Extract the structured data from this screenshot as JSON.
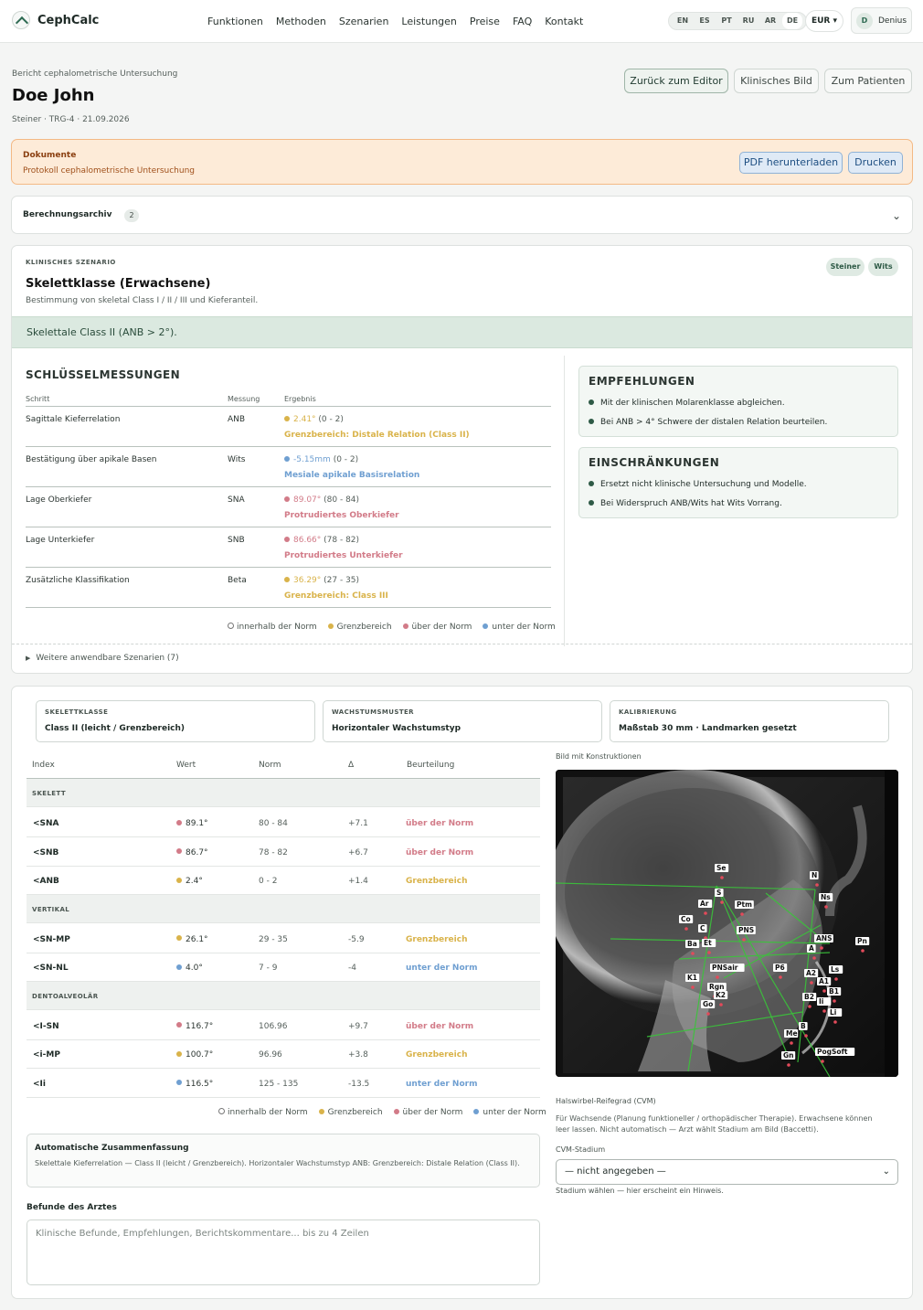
{
  "header": {
    "brand": "CephCalc",
    "nav": [
      "Funktionen",
      "Methoden",
      "Szenarien",
      "Leistungen",
      "Preise",
      "FAQ",
      "Kontakt"
    ],
    "languages": [
      "EN",
      "ES",
      "PT",
      "RU",
      "AR",
      "DE"
    ],
    "active_language": "DE",
    "currency": "EUR ▾",
    "user_initial": "D",
    "user_name": "Denius"
  },
  "page": {
    "breadcrumb": "Bericht cephalometrische Untersuchung",
    "title": "Doe John",
    "meta": "Steiner · TRG-4 · 21.09.2026",
    "buttons": {
      "editor": "Zurück zum Editor",
      "clinical": "Klinisches Bild",
      "patient": "Zum Patienten"
    }
  },
  "documents": {
    "title": "Dokumente",
    "subtitle": "Protokoll cephalometrische Untersuchung",
    "pdf_button": "PDF herunterladen",
    "print_button": "Drucken"
  },
  "archive": {
    "label": "Berechnungsarchiv",
    "count": "2"
  },
  "scenario": {
    "eyebrow": "KLINISCHES SZENARIO",
    "title": "Skelettklasse (Erwachsene)",
    "description": "Bestimmung von skeletal Class I / II / III und Kieferanteil.",
    "tags": [
      "Steiner",
      "Wits"
    ],
    "result": "Skelettale Class II (ANB > 2°).",
    "key_heading": "SCHLÜSSELMESSUNGEN",
    "columns": [
      "Schritt",
      "Messung",
      "Ergebnis"
    ],
    "rows": [
      {
        "step": "Sagittale Kieferrelation",
        "measure": "ANB",
        "value": "2.41°",
        "range": "(0 - 2)",
        "verdict": "Grenzbereich: Distale Relation (Class II)",
        "color": "#d9b34a"
      },
      {
        "step": "Bestätigung über apikale Basen",
        "measure": "Wits",
        "value": "-5.15mm",
        "range": "(0 - 2)",
        "verdict": "Mesiale apikale Basisrelation",
        "color": "#6f9fd1"
      },
      {
        "step": "Lage Oberkiefer",
        "measure": "SNA",
        "value": "89.07°",
        "range": "(80 - 84)",
        "verdict": "Protrudiertes Oberkiefer",
        "color": "#d27b88"
      },
      {
        "step": "Lage Unterkiefer",
        "measure": "SNB",
        "value": "86.66°",
        "range": "(78 - 82)",
        "verdict": "Protrudiertes Unterkiefer",
        "color": "#d27b88"
      },
      {
        "step": "Zusätzliche Klassifikation",
        "measure": "Beta",
        "value": "36.29°",
        "range": "(27 - 35)",
        "verdict": "Grenzbereich: Class III",
        "color": "#d9b34a"
      }
    ],
    "legend": [
      "innerhalb der Norm",
      "Grenzbereich",
      "über der Norm",
      "unter der Norm"
    ],
    "recommendations_title": "EMPFEHLUNGEN",
    "recommendations": [
      "Mit der klinischen Molarenklasse abgleichen.",
      "Bei ANB > 4° Schwere der distalen Relation beurteilen."
    ],
    "limitations_title": "EINSCHRÄNKUNGEN",
    "limitations": [
      "Ersetzt nicht klinische Untersuchung und Modelle.",
      "Bei Widerspruch ANB/Wits hat Wits Vorrang."
    ],
    "more": "Weitere anwendbare Szenarien (7)"
  },
  "analysis": {
    "stats": [
      {
        "key": "SKELETTKLASSE",
        "value": "Class II (leicht / Grenzbereich)"
      },
      {
        "key": "WACHSTUMSMUSTER",
        "value": "Horizontaler Wachstumstyp"
      },
      {
        "key": "KALIBRIERUNG",
        "value": "Maßstab 30 mm · Landmarken gesetzt"
      }
    ],
    "columns": [
      "Index",
      "Wert",
      "Norm",
      "Δ",
      "Beurteilung"
    ],
    "groups": [
      {
        "name": "SKELETT",
        "rows": [
          {
            "index": "<SNA",
            "value": "89.1°",
            "norm": "80 - 84",
            "delta": "+7.1",
            "verdict": "über der Norm",
            "color": "#d27b88"
          },
          {
            "index": "<SNB",
            "value": "86.7°",
            "norm": "78 - 82",
            "delta": "+6.7",
            "verdict": "über der Norm",
            "color": "#d27b88"
          },
          {
            "index": "<ANB",
            "value": "2.4°",
            "norm": "0 - 2",
            "delta": "+1.4",
            "verdict": "Grenzbereich",
            "color": "#d9b34a"
          }
        ]
      },
      {
        "name": "VERTIKAL",
        "rows": [
          {
            "index": "<SN-MP",
            "value": "26.1°",
            "norm": "29 - 35",
            "delta": "-5.9",
            "verdict": "Grenzbereich",
            "color": "#d9b34a"
          },
          {
            "index": "<SN-NL",
            "value": "4.0°",
            "norm": "7 - 9",
            "delta": "-4",
            "verdict": "unter der Norm",
            "color": "#6f9fd1"
          }
        ]
      },
      {
        "name": "DENTOALVEOLÄR",
        "rows": [
          {
            "index": "<I-SN",
            "value": "116.7°",
            "norm": "106.96",
            "delta": "+9.7",
            "verdict": "über der Norm",
            "color": "#d27b88"
          },
          {
            "index": "<i-MP",
            "value": "100.7°",
            "norm": "96.96",
            "delta": "+3.8",
            "verdict": "Grenzbereich",
            "color": "#d9b34a"
          },
          {
            "index": "<Ii",
            "value": "116.5°",
            "norm": "125 - 135",
            "delta": "-13.5",
            "verdict": "unter der Norm",
            "color": "#6f9fd1"
          }
        ]
      }
    ],
    "legend": [
      "innerhalb der Norm",
      "Grenzbereich",
      "über der Norm",
      "unter der Norm"
    ],
    "summary_title": "Automatische Zusammenfassung",
    "summary": "Skelettale Kieferrelation — Class II (leicht / Grenzbereich). Horizontaler Wachstumstyp ANB: Grenzbereich: Distale Relation (Class II).",
    "findings_title": "Befunde des Arztes",
    "findings_placeholder": "Klinische Befunde, Empfehlungen, Berichtskommentare... bis zu 4 Zeilen",
    "image_caption": "Bild mit Konstruktionen",
    "landmarks": [
      "Se",
      "N",
      "S",
      "Ns",
      "Ar",
      "Ptm",
      "Co",
      "C",
      "PNS",
      "ANS",
      "Pn",
      "Ba",
      "Et",
      "A",
      "PNSair",
      "P6",
      "A2",
      "Ls",
      "K1",
      "A1",
      "Rgn",
      "B1",
      "K2",
      "B2",
      "Go",
      "Ii",
      "Li",
      "B",
      "Me",
      "Gn",
      "PogSoft"
    ],
    "cvm_title": "Halswirbel-Reifegrad (CVM)",
    "cvm_text": "Für Wachsende (Planung funktioneller / orthopädischer Therapie). Erwachsene können leer lassen. Nicht automatisch — Arzt wählt Stadium am Bild (Baccetti).",
    "cvm_label": "CVM-Stadium",
    "cvm_value": "— nicht angegeben —",
    "cvm_hint": "Stadium wählen — hier erscheint ein Hinweis."
  },
  "colors": {
    "within": "#ffffff",
    "border": "#d9b34a",
    "above": "#d27b88",
    "below": "#6f9fd1",
    "accent": "#2e5a46"
  }
}
